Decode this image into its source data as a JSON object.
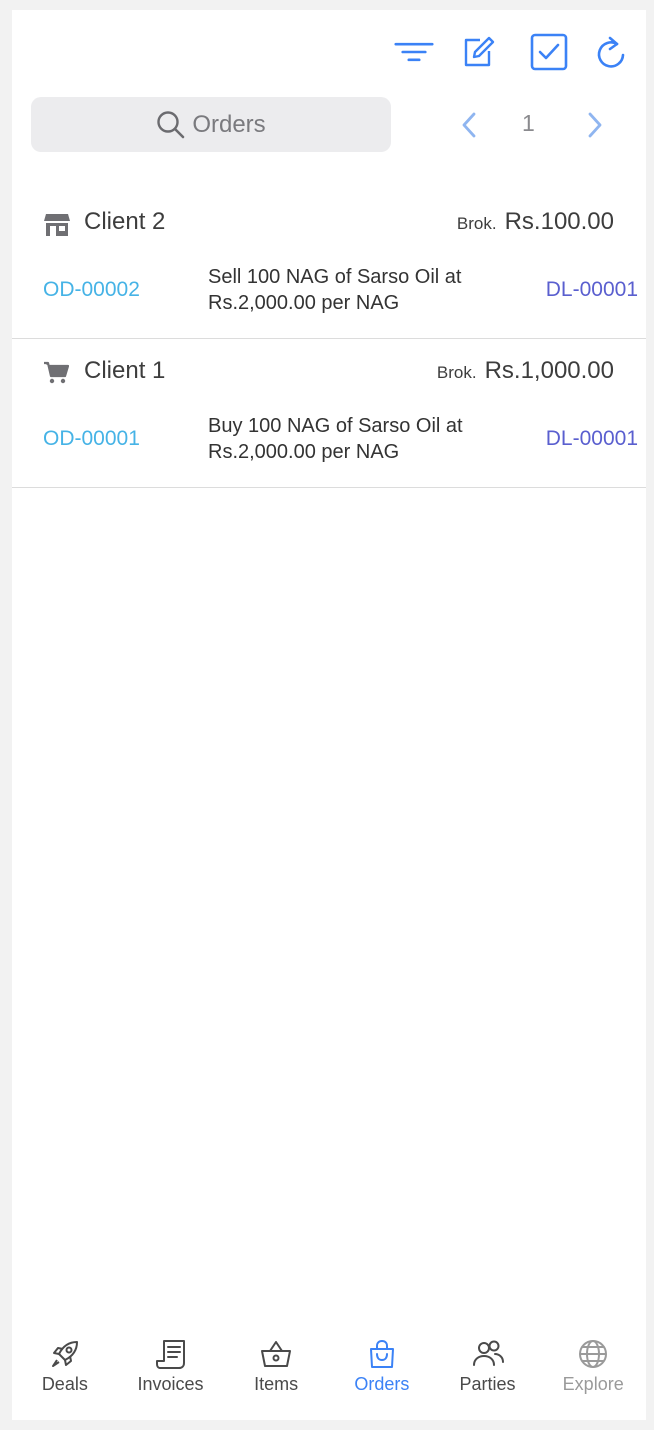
{
  "toolbar": {
    "icons": [
      "filter-icon",
      "edit-icon",
      "checkbox-icon",
      "refresh-icon"
    ],
    "accent": "#3b82f6"
  },
  "search": {
    "placeholder": "Orders"
  },
  "pager": {
    "page": "1"
  },
  "orders": [
    {
      "icon": "store-icon",
      "client": "Client 2",
      "brok_label": "Brok.",
      "brok_amount": "Rs.100.00",
      "order_id": "OD-00002",
      "description": "Sell 100 NAG of Sarso Oil at Rs.2,000.00 per NAG",
      "deal_id": "DL-00001"
    },
    {
      "icon": "cart-icon",
      "client": "Client 1",
      "brok_label": "Brok.",
      "brok_amount": "Rs.1,000.00",
      "order_id": "OD-00001",
      "description": "Buy 100 NAG of Sarso Oil at Rs.2,000.00 per NAG",
      "deal_id": "DL-00001"
    }
  ],
  "nav": {
    "items": [
      {
        "label": "Deals",
        "icon": "rocket-icon"
      },
      {
        "label": "Invoices",
        "icon": "receipt-icon"
      },
      {
        "label": "Items",
        "icon": "basket-icon"
      },
      {
        "label": "Orders",
        "icon": "bag-icon",
        "active": true
      },
      {
        "label": "Parties",
        "icon": "people-icon"
      },
      {
        "label": "Explore",
        "icon": "globe-icon",
        "disabled": true
      }
    ],
    "active_color": "#3b82f6"
  }
}
